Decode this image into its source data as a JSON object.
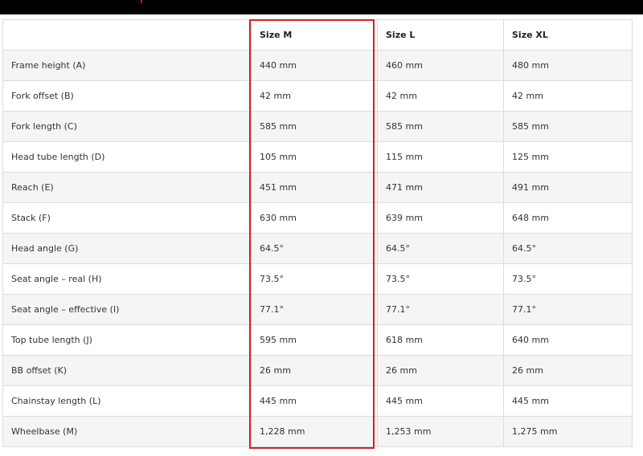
{
  "header": {
    "col_label": "",
    "col_m": "Size M",
    "col_l": "Size L",
    "col_xl": "Size XL"
  },
  "rows": [
    {
      "label": "Frame height (A)",
      "m": "440 mm",
      "l": "460 mm",
      "xl": "480 mm"
    },
    {
      "label": "Fork offset (B)",
      "m": "42 mm",
      "l": "42 mm",
      "xl": "42 mm"
    },
    {
      "label": "Fork length (C)",
      "m": "585 mm",
      "l": "585 mm",
      "xl": "585 mm"
    },
    {
      "label": "Head tube length (D)",
      "m": "105 mm",
      "l": "115 mm",
      "xl": "125 mm"
    },
    {
      "label": "Reach (E)",
      "m": "451 mm",
      "l": "471 mm",
      "xl": "491 mm"
    },
    {
      "label": "Stack (F)",
      "m": "630 mm",
      "l": "639 mm",
      "xl": "648 mm"
    },
    {
      "label": "Head angle (G)",
      "m": "64.5°",
      "l": "64.5°",
      "xl": "64.5°"
    },
    {
      "label": "Seat angle – real (H)",
      "m": "73.5°",
      "l": "73.5°",
      "xl": "73.5°"
    },
    {
      "label": "Seat angle – effective (I)",
      "m": "77.1°",
      "l": "77.1°",
      "xl": "77.1°"
    },
    {
      "label": "Top tube length (J)",
      "m": "595 mm",
      "l": "618 mm",
      "xl": "640 mm"
    },
    {
      "label": "BB offset (K)",
      "m": "26 mm",
      "l": "26 mm",
      "xl": "26 mm"
    },
    {
      "label": "Chainstay length (L)",
      "m": "445 mm",
      "l": "445 mm",
      "xl": "445 mm"
    },
    {
      "label": "Wheelbase (M)",
      "m": "1,228 mm",
      "l": "1,253 mm",
      "xl": "1,275 mm"
    }
  ],
  "colors": {
    "highlight": "#d0202a",
    "topbar": "#000000"
  }
}
